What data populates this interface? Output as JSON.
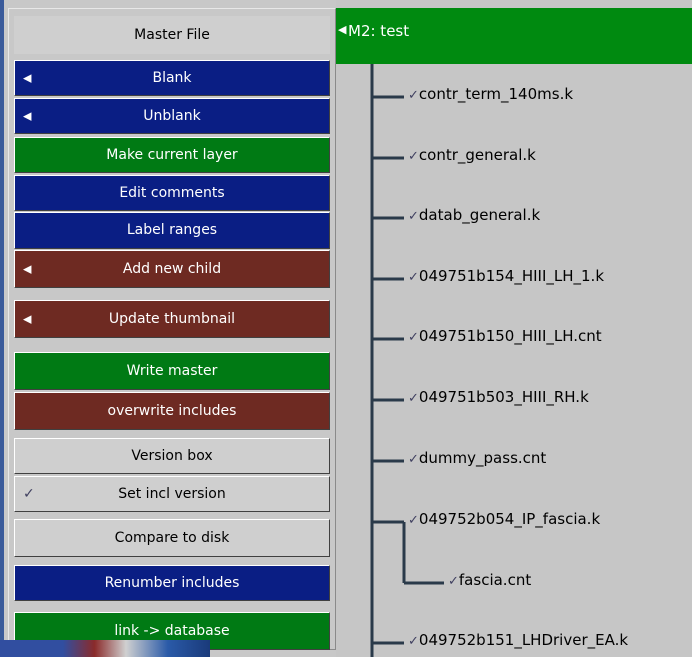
{
  "menu": {
    "title": "Master File",
    "items": [
      {
        "label": "Blank",
        "style": "blue",
        "icon": "triangle-left-icon"
      },
      {
        "label": "Unblank",
        "style": "blue",
        "icon": "triangle-left-icon"
      },
      {
        "label": "Make current layer",
        "style": "green",
        "icon": ""
      },
      {
        "label": "Edit comments",
        "style": "blue",
        "icon": ""
      },
      {
        "label": "Label ranges",
        "style": "blue",
        "icon": ""
      },
      {
        "label": "Add new child",
        "style": "red",
        "icon": "triangle-left-icon"
      },
      {
        "label": "Update thumbnail",
        "style": "red",
        "icon": "triangle-left-icon"
      },
      {
        "label": "Write master",
        "style": "green",
        "icon": ""
      },
      {
        "label": "overwrite includes",
        "style": "red",
        "icon": ""
      },
      {
        "label": "Version box",
        "style": "grey",
        "icon": ""
      },
      {
        "label": "Set incl version",
        "style": "grey",
        "icon": "check-icon"
      },
      {
        "label": "Compare to disk",
        "style": "grey",
        "icon": ""
      },
      {
        "label": "Renumber includes",
        "style": "blue",
        "icon": ""
      },
      {
        "label": "link -> database",
        "style": "green",
        "icon": ""
      }
    ]
  },
  "tree": {
    "root_label": "M2: test",
    "nodes": [
      {
        "label": "contr_term_140ms.k",
        "level": 1
      },
      {
        "label": "contr_general.k",
        "level": 1
      },
      {
        "label": "datab_general.k",
        "level": 1
      },
      {
        "label": "049751b154_HIII_LH_1.k",
        "level": 1
      },
      {
        "label": "049751b150_HIII_LH.cnt",
        "level": 1
      },
      {
        "label": "049751b503_HIII_RH.k",
        "level": 1
      },
      {
        "label": "dummy_pass.cnt",
        "level": 1
      },
      {
        "label": "049752b054_IP_fascia.k",
        "level": 1
      },
      {
        "label": "fascia.cnt",
        "level": 2
      },
      {
        "label": "049752b151_LHDriver_EA.k",
        "level": 1
      }
    ]
  },
  "colors": {
    "blue": "#0a1e84",
    "green": "#007a14",
    "red": "#6e2a22",
    "grey": "#cfcfcf",
    "tree_line": "#2a3a4a",
    "root_bg": "#008a10"
  }
}
